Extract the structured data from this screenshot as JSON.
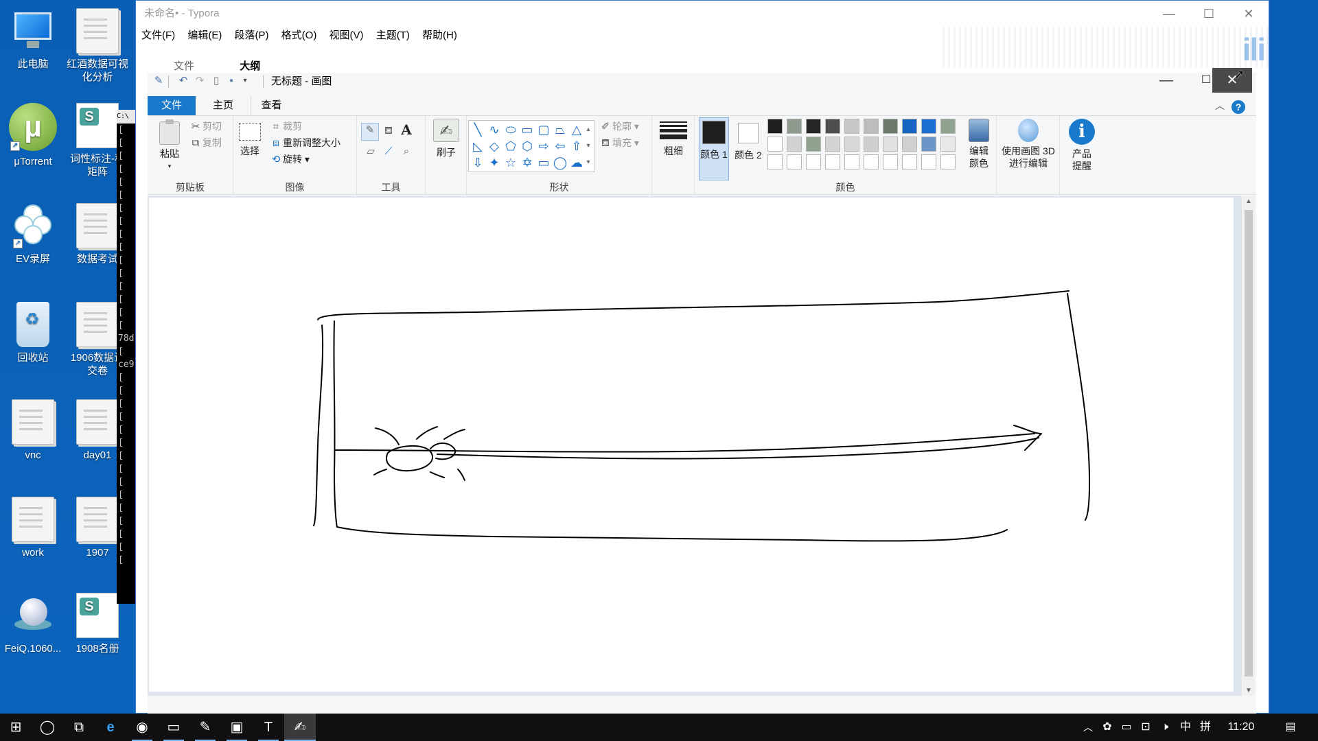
{
  "desktop": {
    "icons": [
      {
        "label": "此电脑"
      },
      {
        "label": "红酒数据可视化分析"
      },
      {
        "label": "μTorrent"
      },
      {
        "label": "词性标注-移矩阵"
      },
      {
        "label": "EV录屏"
      },
      {
        "label": "数据考试"
      },
      {
        "label": "回收站"
      },
      {
        "label": "1906数据试交卷"
      },
      {
        "label": "vnc"
      },
      {
        "label": "day01"
      },
      {
        "label": "work"
      },
      {
        "label": "1907"
      },
      {
        "label": "FeiQ.1060..."
      },
      {
        "label": "1908名册"
      }
    ],
    "terminal_fragments": [
      "78d",
      "ce9"
    ]
  },
  "typora": {
    "title": "未命名• - Typora",
    "menu": [
      "文件(F)",
      "编辑(E)",
      "段落(P)",
      "格式(O)",
      "视图(V)",
      "主题(T)",
      "帮助(H)"
    ],
    "side_tabs": [
      "文件",
      "大纲"
    ],
    "watermark": "ili"
  },
  "paint": {
    "title": "无标题 - 画图",
    "tabs": [
      "文件",
      "主页",
      "查看"
    ],
    "help": "?",
    "clipboard": {
      "paste": "粘贴",
      "cut": "剪切",
      "copy": "复制",
      "group": "剪贴板"
    },
    "image": {
      "select": "选择",
      "crop": "裁剪",
      "resize": "重新调整大小",
      "rotate": "旋转",
      "group": "图像"
    },
    "tools": {
      "group": "工具"
    },
    "brush": {
      "label": "刷子"
    },
    "shapes": {
      "outline": "轮廓",
      "fill": "填充",
      "group": "形状"
    },
    "size": {
      "label": "粗细"
    },
    "colors": {
      "color1": "颜色 1",
      "color2": "颜色 2",
      "edit": "编辑颜色",
      "group": "颜色",
      "color1_value": "#1e1e1e",
      "color2_value": "#ffffff",
      "palette_row1": [
        "#1f1f1f",
        "#8f9a8f",
        "#252525",
        "#4d4f4d",
        "#c8c8c8",
        "#bdbdbd",
        "#6b7a6b",
        "#1565c0",
        "#1a6fd0",
        "#8fa38f"
      ],
      "palette_row2": [
        "#ffffff",
        "#cfd2cf",
        "#8fa38f",
        "#d4d4d4",
        "#d7d7d7",
        "#cfcfcf",
        "#e1e1e1",
        "#d0d0d0",
        "#6a96c8",
        "#e8e8e8"
      ],
      "palette_row3": [
        "#ffffff",
        "#ffffff",
        "#ffffff",
        "#ffffff",
        "#ffffff",
        "#ffffff",
        "#ffffff",
        "#ffffff",
        "#ffffff",
        "#ffffff"
      ]
    },
    "paint3d": {
      "label": "使用画图 3D 进行编辑"
    },
    "product": {
      "label": "产品提醒"
    }
  },
  "taskbar": {
    "time": "11:20",
    "ime_lang": "中",
    "ime_mode": "拼"
  }
}
